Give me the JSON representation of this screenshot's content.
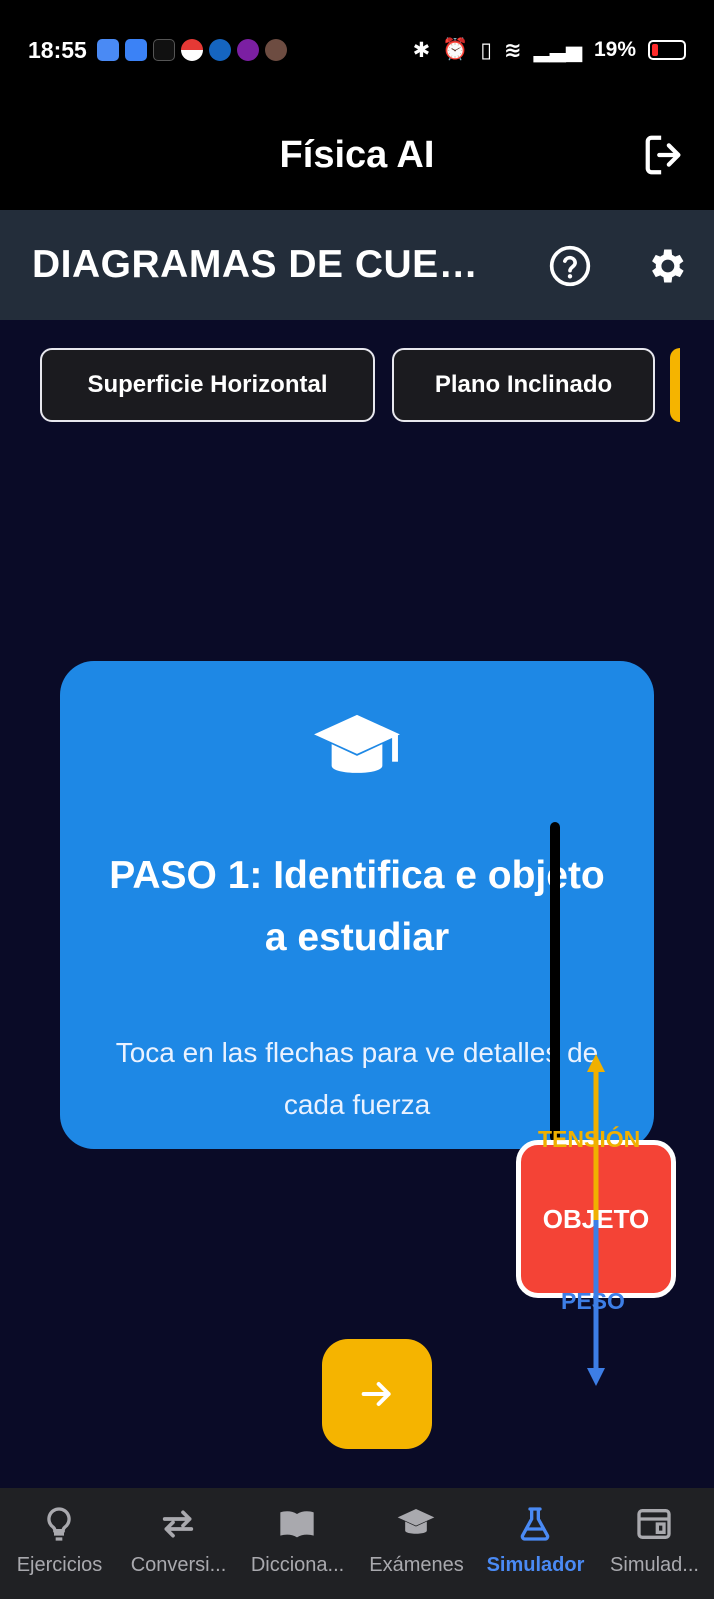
{
  "status_bar": {
    "time": "18:55",
    "battery": "19%"
  },
  "app_bar": {
    "title": "Física AI",
    "logout_icon": "logout-icon"
  },
  "section": {
    "title": "DIAGRAMAS DE CUER...",
    "help_icon": "help-circle-icon",
    "settings_icon": "gear-icon"
  },
  "chips": [
    {
      "label": "Superficie Horizontal"
    },
    {
      "label": "Plano Inclinado"
    }
  ],
  "card": {
    "icon": "graduation-cap-icon",
    "step_title": "PASO 1: Identifica e objeto a estudiar",
    "hint": "Toca en las flechas para ve detalles de cada fuerza"
  },
  "simulation": {
    "object_label": "OBJETO",
    "tension_label": "TENSIÓN",
    "weight_label": "PESO",
    "tension_color": "#f0b000",
    "weight_color": "#3d7ee6",
    "object_color": "#f44336"
  },
  "next_button": {
    "icon": "arrow-right-icon",
    "color": "#f5b400"
  },
  "bottom_nav": [
    {
      "label": "Ejercicios",
      "icon": "lightbulb-icon"
    },
    {
      "label": "Conversi...",
      "icon": "swap-arrows-icon"
    },
    {
      "label": "Dicciona...",
      "icon": "book-icon"
    },
    {
      "label": "Exámenes",
      "icon": "graduation-cap-icon"
    },
    {
      "label": "Simulador",
      "icon": "flask-icon",
      "active": true
    },
    {
      "label": "Simulad...",
      "icon": "window-icon"
    }
  ]
}
